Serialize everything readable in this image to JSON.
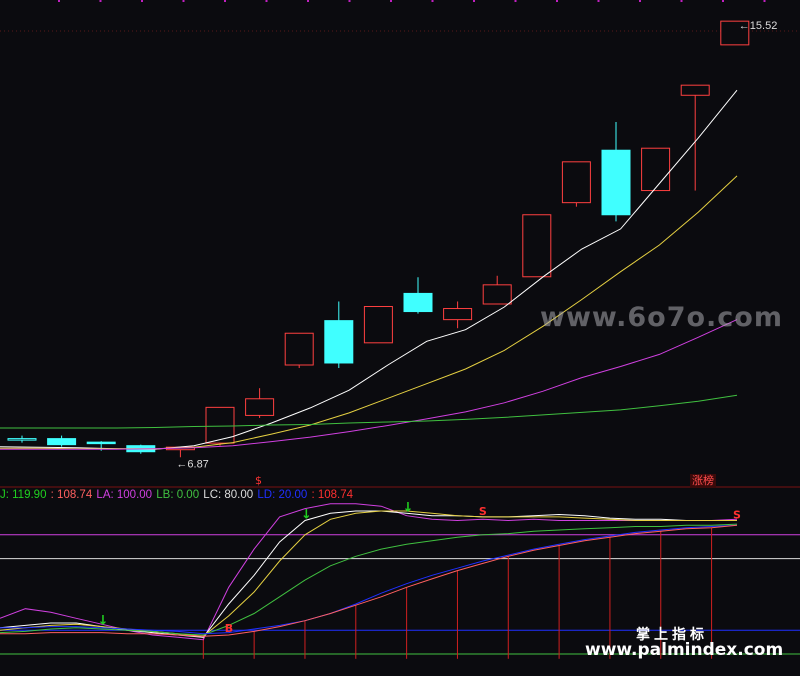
{
  "chart_data": [
    {
      "type": "candlestick",
      "title": "",
      "price_labels": {
        "high_label": "15.52",
        "low_label": "6.87"
      },
      "ylim": [
        6.3,
        15.9
      ],
      "candles": [
        {
          "open": 7.23,
          "close": 7.24,
          "high": 7.3,
          "low": 7.16,
          "color": "#40ffff"
        },
        {
          "open": 7.24,
          "close": 7.12,
          "high": 7.3,
          "low": 7.08,
          "color": "#40ffff"
        },
        {
          "open": 7.17,
          "close": 7.16,
          "high": 7.19,
          "low": 7.0,
          "color": "#40ffff"
        },
        {
          "open": 7.1,
          "close": 6.98,
          "high": 7.12,
          "low": 6.94,
          "color": "#40ffff"
        },
        {
          "open": 7.02,
          "close": 7.07,
          "high": 7.07,
          "low": 6.87,
          "color": "#ff4040"
        },
        {
          "open": 7.15,
          "close": 7.86,
          "high": 7.86,
          "low": 7.1,
          "color": "#ff4040"
        },
        {
          "open": 7.7,
          "close": 8.03,
          "high": 8.24,
          "low": 7.65,
          "color": "#ff4040"
        },
        {
          "open": 8.7,
          "close": 9.33,
          "high": 9.33,
          "low": 8.64,
          "color": "#ff4040"
        },
        {
          "open": 9.58,
          "close": 8.74,
          "high": 9.96,
          "low": 8.64,
          "color": "#40ffff"
        },
        {
          "open": 9.14,
          "close": 9.86,
          "high": 9.86,
          "low": 9.14,
          "color": "#ff4040"
        },
        {
          "open": 10.12,
          "close": 9.76,
          "high": 10.44,
          "low": 9.72,
          "color": "#40ffff"
        },
        {
          "open": 9.6,
          "close": 9.82,
          "high": 9.96,
          "low": 9.43,
          "color": "#ff4040"
        },
        {
          "open": 9.91,
          "close": 10.29,
          "high": 10.47,
          "low": 9.91,
          "color": "#ff4040"
        },
        {
          "open": 10.45,
          "close": 11.68,
          "high": 11.68,
          "low": 10.45,
          "color": "#ff4040"
        },
        {
          "open": 11.92,
          "close": 12.73,
          "high": 12.73,
          "low": 11.84,
          "color": "#ff4040"
        },
        {
          "open": 12.96,
          "close": 11.68,
          "high": 13.52,
          "low": 11.55,
          "color": "#40ffff"
        },
        {
          "open": 12.16,
          "close": 13.0,
          "high": 13.0,
          "low": 12.16,
          "color": "#ff4040"
        },
        {
          "open": 14.05,
          "close": 14.25,
          "high": 14.25,
          "low": 12.16,
          "color": "#ff4040"
        },
        {
          "open": 15.05,
          "close": 15.52,
          "high": 15.52,
          "low": 15.05,
          "color": "#ff4040"
        }
      ],
      "series": [
        {
          "color": "#ffffff",
          "values": [
            7.08,
            7.07,
            7.06,
            7.04,
            7.03,
            7.1,
            7.28,
            7.55,
            7.85,
            8.2,
            8.7,
            9.17,
            9.4,
            9.85,
            10.45,
            11.0,
            11.4,
            12.3,
            13.2,
            14.15
          ]
        },
        {
          "color": "#e5d042",
          "values": [
            7.05,
            7.05,
            7.04,
            7.04,
            7.04,
            7.07,
            7.16,
            7.33,
            7.51,
            7.75,
            8.04,
            8.33,
            8.62,
            8.99,
            9.47,
            10.0,
            10.55,
            11.08,
            11.73,
            12.45
          ]
        },
        {
          "color": "#d040e0",
          "values": [
            7.03,
            7.03,
            7.03,
            7.03,
            7.04,
            7.06,
            7.1,
            7.18,
            7.27,
            7.38,
            7.5,
            7.63,
            7.77,
            7.95,
            8.18,
            8.45,
            8.67,
            8.91,
            9.25,
            9.6
          ]
        },
        {
          "color": "#40c040",
          "values": [
            7.45,
            7.45,
            7.45,
            7.45,
            7.46,
            7.48,
            7.49,
            7.51,
            7.52,
            7.55,
            7.57,
            7.59,
            7.62,
            7.66,
            7.71,
            7.76,
            7.81,
            7.89,
            7.98,
            8.1
          ]
        }
      ],
      "markers": [
        {
          "label": "$",
          "color": "#ff3333"
        },
        {
          "label": "涨榜",
          "color": "#ff4d4d"
        }
      ]
    },
    {
      "type": "line",
      "title": "",
      "legend": [
        {
          "text": "J: 119.90",
          "color": "#20d020"
        },
        {
          "text": ": 108.74",
          "color": "#ff6060"
        },
        {
          "text": "LA: 100.00",
          "color": "#d040e0"
        },
        {
          "text": "LB: 0.00",
          "color": "#40c040"
        },
        {
          "text": "LC: 80.00",
          "color": "#dddddd"
        },
        {
          "text": "LD: 20.00",
          "color": "#2030ff"
        },
        {
          "text": ": 108.74",
          "color": "#ff3030"
        }
      ],
      "ylim": [
        -5,
        125
      ],
      "reference_lines": [
        {
          "name": "LA",
          "value": 100,
          "color": "#d040e0"
        },
        {
          "name": "LC",
          "value": 80,
          "color": "#dddddd"
        },
        {
          "name": "LD",
          "value": 20,
          "color": "#2030ff"
        },
        {
          "name": "LB",
          "value": 0,
          "color": "#40c040"
        }
      ],
      "series": [
        {
          "color": "#d040e0",
          "values": [
            30,
            38,
            35,
            30,
            25,
            20,
            16,
            14,
            12,
            56,
            88,
            115,
            122,
            126,
            126,
            124,
            116,
            113,
            112,
            113,
            112,
            113,
            112,
            112,
            112,
            112,
            112,
            112,
            112,
            113
          ]
        },
        {
          "color": "#ffffff",
          "values": [
            22,
            24,
            26,
            26,
            23,
            20,
            18,
            16,
            14,
            42,
            66,
            94,
            112,
            118,
            120,
            120,
            118,
            116,
            116,
            115,
            115,
            116,
            117,
            116,
            114,
            113,
            113,
            112,
            112,
            112
          ]
        },
        {
          "color": "#e5d042",
          "values": [
            20,
            22,
            24,
            25,
            23,
            21,
            19,
            17,
            15,
            32,
            52,
            78,
            100,
            113,
            118,
            120,
            120,
            118,
            116,
            115,
            115,
            115,
            115,
            114,
            113,
            112,
            112,
            112,
            112,
            112
          ]
        },
        {
          "color": "#40c040",
          "values": [
            18,
            19,
            21,
            22,
            21,
            20,
            19,
            17,
            16,
            24,
            34,
            48,
            62,
            74,
            82,
            88,
            92,
            95,
            98,
            100,
            101,
            103,
            104,
            105,
            106,
            107,
            107,
            108,
            108,
            109
          ]
        },
        {
          "color": "#2030ff",
          "values": [
            22,
            22,
            23,
            23,
            22,
            21,
            20,
            19,
            17,
            18,
            21,
            24,
            28,
            34,
            42,
            51,
            59,
            66,
            72,
            78,
            83,
            88,
            92,
            96,
            99,
            102,
            104,
            106,
            107,
            108
          ]
        },
        {
          "color": "#ff6060",
          "values": [
            17,
            17,
            18,
            18,
            18,
            17,
            17,
            16,
            15,
            16,
            19,
            23,
            28,
            34,
            41,
            48,
            56,
            63,
            70,
            76,
            82,
            87,
            91,
            95,
            98,
            101,
            103,
            105,
            106,
            108
          ]
        }
      ],
      "signals": [
        {
          "label": "↓",
          "color": "#20d020"
        },
        {
          "label": "↓",
          "color": "#20d020"
        },
        {
          "label": "↓",
          "color": "#20d020"
        },
        {
          "label": "B",
          "color": "#ff3030"
        },
        {
          "label": "S",
          "color": "#ff3030"
        },
        {
          "label": "S",
          "color": "#ff3030"
        }
      ]
    }
  ],
  "overlay": {
    "dollar": "$",
    "badge": "涨榜",
    "watermark_site": "www.6o7o.com",
    "watermark_cn": "掌上指标",
    "watermark_url": "www.palmindex.com"
  }
}
